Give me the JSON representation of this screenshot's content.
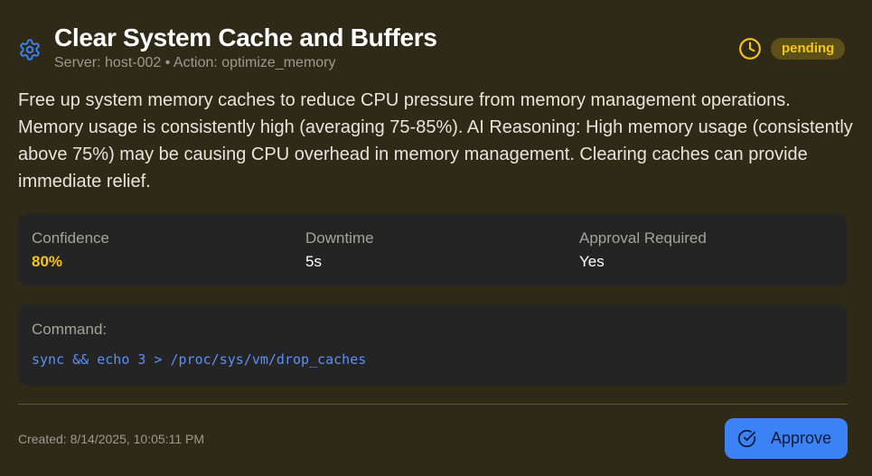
{
  "header": {
    "icon": "gear-icon",
    "title": "Clear System Cache and Buffers",
    "subtitle": "Server: host-002 • Action: optimize_memory",
    "status_icon": "clock-icon",
    "status": "pending"
  },
  "description": "Free up system memory caches to reduce CPU pressure from memory management operations. Memory usage is consistently high (averaging 75-85%). AI Reasoning: High memory usage (consistently above 75%) may be causing CPU overhead in memory management. Clearing caches can provide immediate relief.",
  "metrics": [
    {
      "label": "Confidence",
      "value": "80%"
    },
    {
      "label": "Downtime",
      "value": "5s"
    },
    {
      "label": "Approval Required",
      "value": "Yes"
    }
  ],
  "command": {
    "label": "Command:",
    "code": "sync && echo 3 > /proc/sys/vm/drop_caches"
  },
  "footer": {
    "created": "Created: 8/14/2025, 10:05:11 PM",
    "approve_label": "Approve",
    "approve_icon": "check-circle-icon"
  },
  "colors": {
    "background": "#2f2a17",
    "accent": "#f5c518",
    "primary": "#3b82f6",
    "code": "#5b8ff9"
  }
}
